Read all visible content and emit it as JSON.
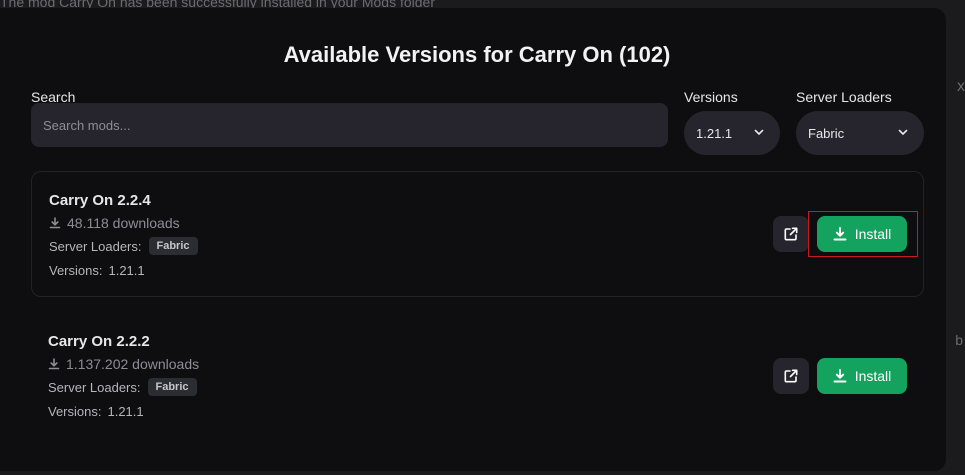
{
  "background": {
    "toast_text": "The mod Carry On has been successfully installed in your Mods folder",
    "side_x": "x",
    "side_b": "b"
  },
  "modal": {
    "title": "Available Versions for Carry On (102)",
    "search": {
      "label": "Search",
      "placeholder": "Search mods...",
      "value": ""
    },
    "versions_filter": {
      "label": "Versions",
      "selected": "1.21.1"
    },
    "loaders_filter": {
      "label": "Server Loaders",
      "selected": "Fabric"
    }
  },
  "versions": [
    {
      "name": "Carry On 2.2.4",
      "downloads": "48.118 downloads",
      "loaders_label": "Server Loaders:",
      "loader": "Fabric",
      "versions_label": "Versions:",
      "game_version": "1.21.1",
      "install_label": "Install",
      "highlighted": true
    },
    {
      "name": "Carry On 2.2.2",
      "downloads": "1.137.202 downloads",
      "loaders_label": "Server Loaders:",
      "loader": "Fabric",
      "versions_label": "Versions:",
      "game_version": "1.21.1",
      "install_label": "Install",
      "highlighted": false
    }
  ],
  "icons": {
    "download": "download-icon",
    "external_link": "external-link-icon",
    "chevron": "chevron-down-icon"
  },
  "colors": {
    "accent": "#14a35f",
    "highlight": "#c21c1c"
  }
}
